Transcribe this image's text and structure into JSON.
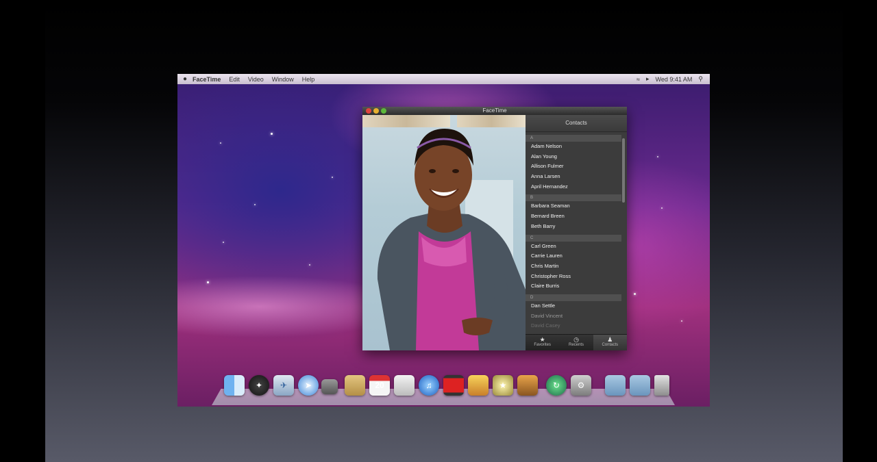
{
  "menubar": {
    "apple": "",
    "app_name": "FaceTime",
    "items": [
      "Edit",
      "Video",
      "Window",
      "Help"
    ],
    "clock": "Wed 9:41 AM"
  },
  "window": {
    "title": "FaceTime",
    "contacts_header": "Contacts",
    "sections": [
      {
        "letter": "A",
        "names": [
          "Adam Nelson",
          "Alan Young",
          "Allison Fulmer",
          "Anna Larsen",
          "April Hernandez"
        ]
      },
      {
        "letter": "B",
        "names": [
          "Barbara Seaman",
          "Bernard Breen",
          "Beth Barry"
        ]
      },
      {
        "letter": "C",
        "names": [
          "Carl Green",
          "Carrie Lauren",
          "Chris Martin",
          "Christopher Ross",
          "Claire Burris"
        ]
      },
      {
        "letter": "D",
        "names": [
          "Dan Settle",
          "David Vincent",
          "David Casey"
        ]
      }
    ],
    "tabs": [
      {
        "label": "Favorites",
        "icon": "star-icon"
      },
      {
        "label": "Recents",
        "icon": "clock-icon"
      },
      {
        "label": "Contacts",
        "icon": "person-icon"
      }
    ]
  },
  "dock": {
    "calendar_day": "20",
    "items": [
      "finder-icon",
      "dashboard-icon",
      "mail-icon",
      "safari-icon",
      "facetime-icon",
      "address-book-icon",
      "ical-icon",
      "preview-icon",
      "itunes-icon",
      "photo-booth-icon",
      "iphoto-icon",
      "imovie-icon",
      "garageband-icon",
      "time-machine-icon",
      "system-preferences-icon",
      "applications-folder-icon",
      "documents-folder-icon",
      "trash-icon"
    ]
  }
}
